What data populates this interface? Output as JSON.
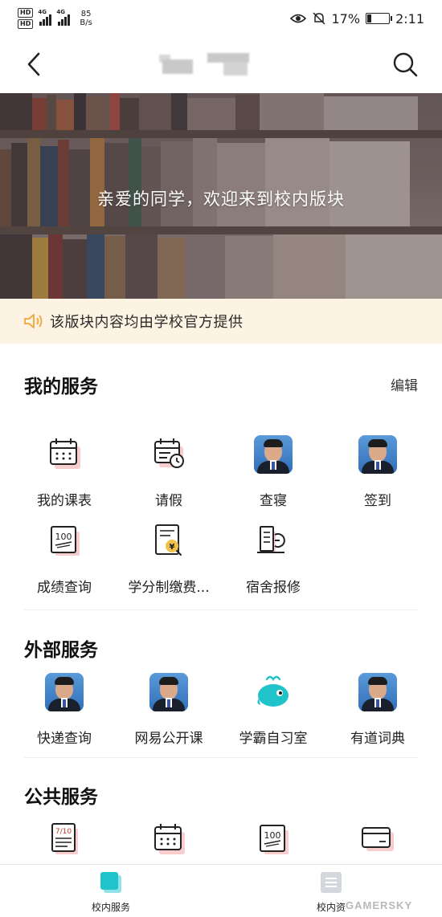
{
  "status_bar": {
    "hd1": "HD",
    "hd2": "HD",
    "net1": "4G",
    "net2": "4G",
    "speed_value": "85",
    "speed_unit": "B/s",
    "battery": "17%",
    "time": "2:11"
  },
  "header": {
    "back_icon": "back-arrow-icon",
    "search_icon": "search-icon"
  },
  "banner": {
    "welcome_text": "亲爱的同学，欢迎来到校内版块"
  },
  "notice": {
    "icon": "speaker-icon",
    "text": "该版块内容均由学校官方提供"
  },
  "my_services": {
    "title": "我的服务",
    "edit_label": "编辑",
    "items": [
      {
        "label": "我的课表",
        "icon": "calendar-icon"
      },
      {
        "label": "请假",
        "icon": "leave-calendar-clock-icon"
      },
      {
        "label": "查寝",
        "icon": "avatar-photo"
      },
      {
        "label": "签到",
        "icon": "avatar-photo"
      },
      {
        "label": "成绩查询",
        "icon": "score-100-icon"
      },
      {
        "label": "学分制缴费...",
        "icon": "yen-payment-icon"
      },
      {
        "label": "宿舍报修",
        "icon": "dorm-repair-icon"
      }
    ]
  },
  "external_services": {
    "title": "外部服务",
    "items": [
      {
        "label": "快递查询",
        "icon": "avatar-photo"
      },
      {
        "label": "网易公开课",
        "icon": "avatar-photo"
      },
      {
        "label": "学霸自习室",
        "icon": "whale-icon"
      },
      {
        "label": "有道词典",
        "icon": "avatar-photo"
      }
    ]
  },
  "public_services": {
    "title": "公共服务",
    "items": [
      {
        "icon": "calendar-page-icon",
        "page_number": "7/10"
      },
      {
        "icon": "calendar-icon"
      },
      {
        "icon": "score-100-icon"
      },
      {
        "icon": "card-icon"
      }
    ]
  },
  "tabbar": {
    "tabs": [
      {
        "label": "校内服务",
        "icon": "school-service-tab-icon",
        "active": true
      },
      {
        "label": "校内资",
        "icon": "school-info-tab-icon",
        "active": false
      }
    ]
  },
  "watermark": {
    "text": "GAMERSKY"
  },
  "colors": {
    "accent_teal": "#20c3c9",
    "notice_bg": "#fdf3e2",
    "notice_icon": "#f2a33a",
    "icon_shadow_pink": "#f4b8b8"
  }
}
